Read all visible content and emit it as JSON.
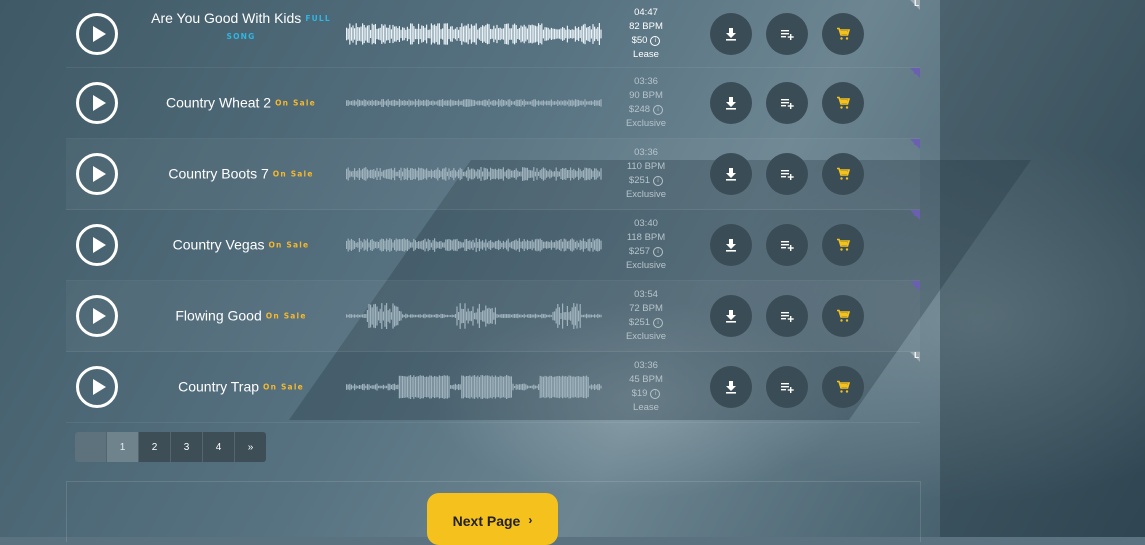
{
  "tracks": [
    {
      "title": "Are You Good With Kids",
      "tag": "FULL SONG",
      "tag_type": "full",
      "duration": "04:47",
      "bpm": "82 BPM",
      "price": "$50",
      "license": "Lease",
      "corner": "L",
      "active": true
    },
    {
      "title": "Country Wheat 2",
      "tag": "On Sale",
      "tag_type": "sale",
      "duration": "03:36",
      "bpm": "90 BPM",
      "price": "$248",
      "license": "Exclusive",
      "corner": "E",
      "active": false
    },
    {
      "title": "Country Boots 7",
      "tag": "On Sale",
      "tag_type": "sale",
      "duration": "03:36",
      "bpm": "110 BPM",
      "price": "$251",
      "license": "Exclusive",
      "corner": "E",
      "active": false
    },
    {
      "title": "Country Vegas",
      "tag": "On Sale",
      "tag_type": "sale",
      "duration": "03:40",
      "bpm": "118 BPM",
      "price": "$257",
      "license": "Exclusive",
      "corner": "E",
      "active": false
    },
    {
      "title": "Flowing Good",
      "tag": "On Sale",
      "tag_type": "sale",
      "duration": "03:54",
      "bpm": "72 BPM",
      "price": "$251",
      "license": "Exclusive",
      "corner": "E",
      "active": false
    },
    {
      "title": "Country Trap",
      "tag": "On Sale",
      "tag_type": "sale",
      "duration": "03:36",
      "bpm": "45 BPM",
      "price": "$19",
      "license": "Lease",
      "corner": "L",
      "active": false
    }
  ],
  "info_icon_label": "i",
  "pagination": {
    "pages": [
      "1",
      "2",
      "3",
      "4"
    ],
    "next": "»",
    "current": "1"
  },
  "next_page_label": "Next Page",
  "next_page_chevron": "›",
  "colors": {
    "accent": "#f5c11c",
    "sale_tag": "#f5b82e",
    "full_tag": "#2fb6e3",
    "cart_icon": "#f5c11c",
    "exclusive_corner": "#6a5fb0"
  }
}
